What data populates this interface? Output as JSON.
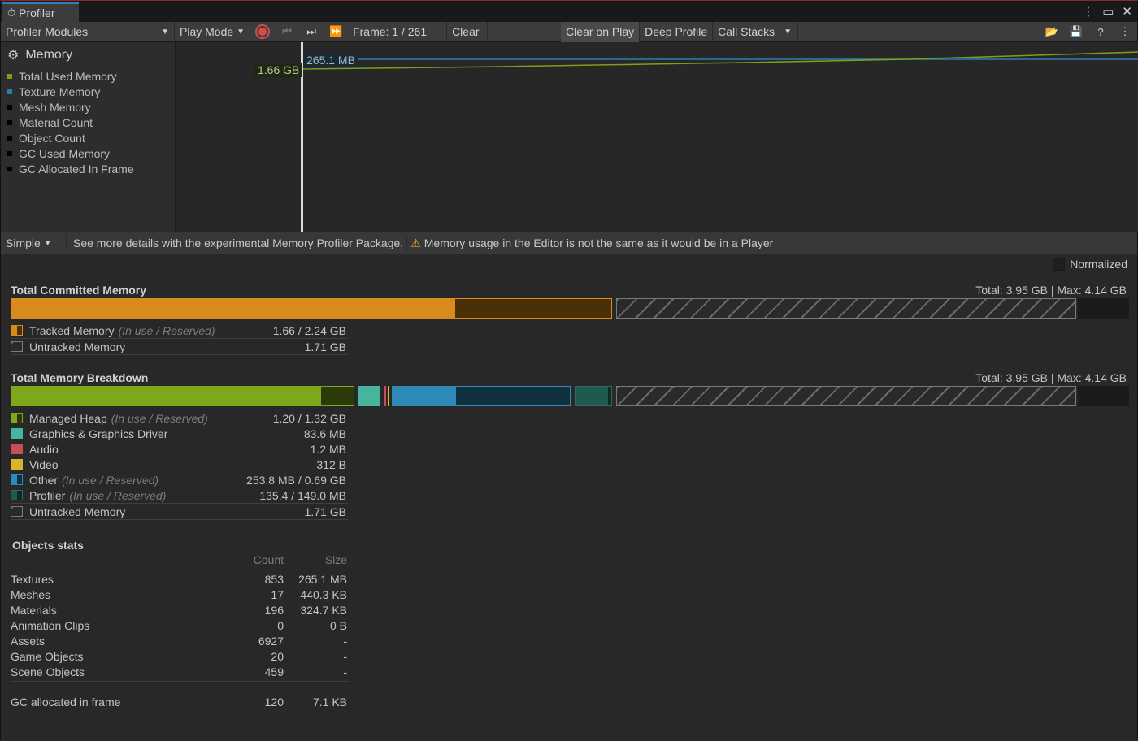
{
  "window": {
    "title": "Profiler"
  },
  "toolbar": {
    "modules_label": "Profiler Modules",
    "play_mode_label": "Play Mode",
    "frame_label": "Frame: 1 / 261",
    "clear_label": "Clear",
    "clear_on_play_label": "Clear on Play",
    "deep_profile_label": "Deep Profile",
    "call_stacks_label": "Call Stacks"
  },
  "module": {
    "title": "Memory",
    "series": [
      {
        "label": "Total Used Memory",
        "color": "#7ba11b"
      },
      {
        "label": "Texture Memory",
        "color": "#2c7bb0"
      },
      {
        "label": "Mesh Memory",
        "color": "#000000"
      },
      {
        "label": "Material Count",
        "color": "#000000"
      },
      {
        "label": "Object Count",
        "color": "#000000"
      },
      {
        "label": "GC Used Memory",
        "color": "#000000"
      },
      {
        "label": "GC Allocated In Frame",
        "color": "#000000"
      }
    ]
  },
  "chart": {
    "texture_value_label": "265.1 MB",
    "total_value_label": "1.66 GB"
  },
  "details": {
    "view_mode": "Simple",
    "package_hint": "See more details with the experimental Memory Profiler Package.",
    "warning": "Memory usage in the Editor is not the same as it would be in a Player"
  },
  "main": {
    "normalized_label": "Normalized",
    "committed": {
      "title": "Total Committed Memory",
      "totals": "Total: 3.95 GB | Max: 4.14 GB",
      "rows": [
        {
          "label": "Tracked Memory",
          "sub": "(In use / Reserved)",
          "value": "1.66 / 2.24 GB"
        },
        {
          "label": "Untracked Memory",
          "sub": "",
          "value": "1.71 GB"
        }
      ]
    },
    "breakdown": {
      "title": "Total Memory Breakdown",
      "totals": "Total: 3.95 GB | Max: 4.14 GB",
      "rows": [
        {
          "label": "Managed Heap",
          "sub": "(In use / Reserved)",
          "value": "1.20 / 1.32 GB"
        },
        {
          "label": "Graphics & Graphics Driver",
          "sub": "",
          "value": "83.6 MB"
        },
        {
          "label": "Audio",
          "sub": "",
          "value": "1.2 MB"
        },
        {
          "label": "Video",
          "sub": "",
          "value": "312 B"
        },
        {
          "label": "Other",
          "sub": "(In use / Reserved)",
          "value": "253.8 MB / 0.69 GB"
        },
        {
          "label": "Profiler",
          "sub": "(In use / Reserved)",
          "value": "135.4 / 149.0 MB"
        },
        {
          "label": "Untracked Memory",
          "sub": "",
          "value": "1.71 GB"
        }
      ]
    },
    "objects": {
      "title": "Objects stats",
      "col_count": "Count",
      "col_size": "Size",
      "rows": [
        {
          "label": "Textures",
          "count": "853",
          "size": "265.1 MB"
        },
        {
          "label": "Meshes",
          "count": "17",
          "size": "440.3 KB"
        },
        {
          "label": "Materials",
          "count": "196",
          "size": "324.7 KB"
        },
        {
          "label": "Animation Clips",
          "count": "0",
          "size": "0 B"
        },
        {
          "label": "Assets",
          "count": "6927",
          "size": "-"
        },
        {
          "label": "Game Objects",
          "count": "20",
          "size": "-"
        },
        {
          "label": "Scene Objects",
          "count": "459",
          "size": "-"
        }
      ],
      "gc": {
        "label": "GC allocated in frame",
        "count": "120",
        "size": "7.1 KB"
      }
    }
  },
  "colors": {
    "tracked": "#d98b1e",
    "managed": "#7fa81e",
    "graphics": "#47b59e",
    "audio": "#c74e55",
    "video": "#d6b42b",
    "other": "#2e8ab8",
    "profiler": "#1f5a52"
  }
}
